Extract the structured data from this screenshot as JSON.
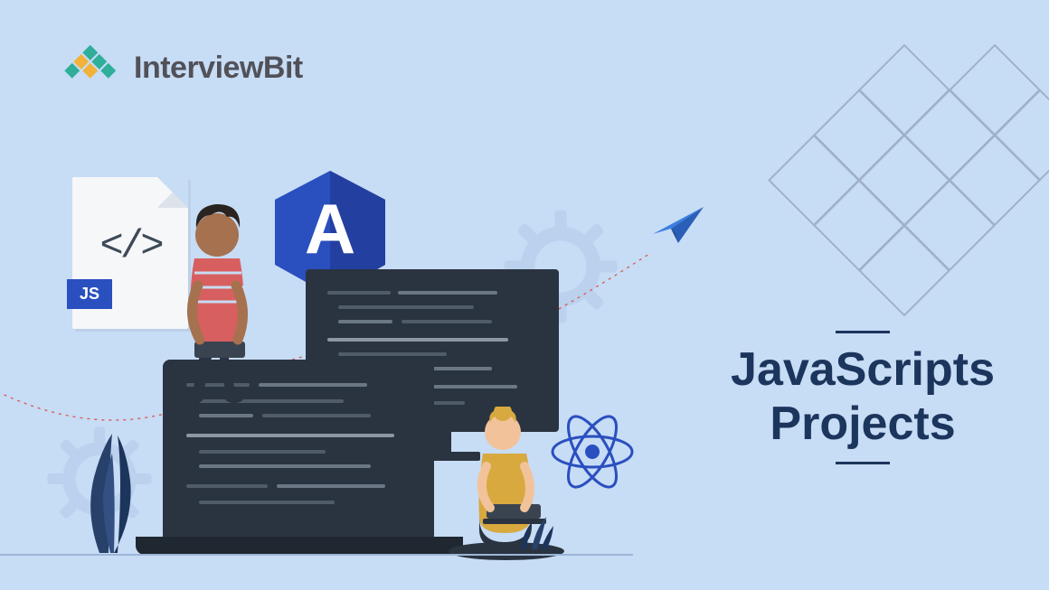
{
  "logo": {
    "text": "InterviewBit"
  },
  "title": {
    "line1": "JavaScripts",
    "line2": "Projects"
  },
  "badges": {
    "js": "JS",
    "angular": "A",
    "code": "</>"
  }
}
